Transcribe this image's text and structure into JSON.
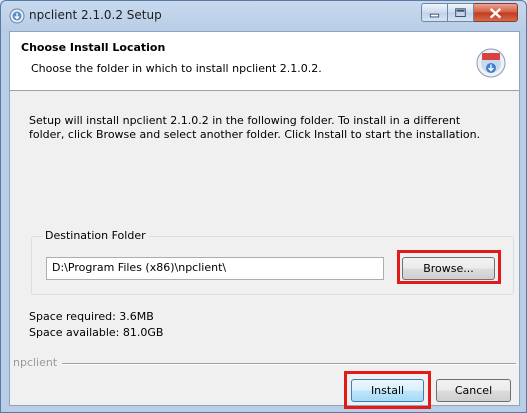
{
  "window": {
    "title": "npclient 2.1.0.2 Setup"
  },
  "header": {
    "title": "Choose Install Location",
    "subtitle": "Choose the folder in which to install npclient 2.1.0.2."
  },
  "body": {
    "intro": "Setup will install npclient 2.1.0.2 in the following folder. To install in a different folder, click Browse and select another folder. Click Install to start the installation."
  },
  "destination": {
    "label": "Destination Folder",
    "value": "D:\\Program Files (x86)\\npclient\\",
    "browse_label": "Browse..."
  },
  "space": {
    "required": "Space required: 3.6MB",
    "available": "Space available: 81.0GB"
  },
  "footer": {
    "brand": "npclient",
    "install_label": "Install",
    "cancel_label": "Cancel"
  },
  "colors": {
    "highlight": "#e31a1a"
  }
}
